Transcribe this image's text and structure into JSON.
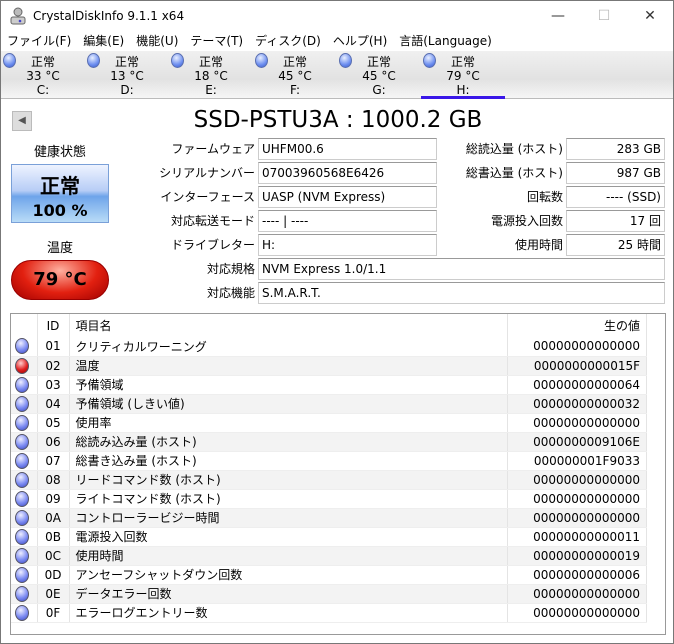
{
  "window": {
    "title": "CrystalDiskInfo 9.1.1 x64",
    "minimize": "—",
    "maximize": "☐",
    "close": "✕"
  },
  "menu": [
    "ファイル(F)",
    "編集(E)",
    "機能(U)",
    "テーマ(T)",
    "ディスク(D)",
    "ヘルプ(H)",
    "言語(Language)"
  ],
  "drives": [
    {
      "status": "正常",
      "temp": "33 °C",
      "letter": "C:"
    },
    {
      "status": "正常",
      "temp": "13 °C",
      "letter": "D:"
    },
    {
      "status": "正常",
      "temp": "18 °C",
      "letter": "E:"
    },
    {
      "status": "正常",
      "temp": "45 °C",
      "letter": "F:"
    },
    {
      "status": "正常",
      "temp": "45 °C",
      "letter": "G:"
    },
    {
      "status": "正常",
      "temp": "79 °C",
      "letter": "H:"
    }
  ],
  "disk_title": "SSD-PSTU3A : 1000.2 GB",
  "back_icon": "◀",
  "health": {
    "label": "健康状態",
    "status": "正常",
    "percent": "100 %"
  },
  "temperature": {
    "label": "温度",
    "value": "79 °C"
  },
  "info": {
    "firmware": {
      "label": "ファームウェア",
      "value": "UHFM00.6"
    },
    "serial": {
      "label": "シリアルナンバー",
      "value": "07003960568E6426"
    },
    "interface": {
      "label": "インターフェース",
      "value": "UASP (NVM Express)"
    },
    "transfer": {
      "label": "対応転送モード",
      "value": "---- | ----"
    },
    "drive_letter": {
      "label": "ドライブレター",
      "value": "H:"
    },
    "standard": {
      "label": "対応規格",
      "value": "NVM Express 1.0/1.1"
    },
    "features": {
      "label": "対応機能",
      "value": "S.M.A.R.T."
    },
    "host_reads": {
      "label": "総読込量 (ホスト)",
      "value": "283 GB"
    },
    "host_writes": {
      "label": "総書込量 (ホスト)",
      "value": "987 GB"
    },
    "rotation": {
      "label": "回転数",
      "value": "---- (SSD)"
    },
    "power_count": {
      "label": "電源投入回数",
      "value": "17 回"
    },
    "power_hours": {
      "label": "使用時間",
      "value": "25 時間"
    }
  },
  "smart": {
    "headers": {
      "id": "ID",
      "name": "項目名",
      "raw": "生の値"
    },
    "rows": [
      {
        "status": "good",
        "id": "01",
        "name": "クリティカルワーニング",
        "raw": "00000000000000"
      },
      {
        "status": "bad",
        "id": "02",
        "name": "温度",
        "raw": "0000000000015F"
      },
      {
        "status": "good",
        "id": "03",
        "name": "予備領域",
        "raw": "00000000000064"
      },
      {
        "status": "good",
        "id": "04",
        "name": "予備領域 (しきい値)",
        "raw": "00000000000032"
      },
      {
        "status": "good",
        "id": "05",
        "name": "使用率",
        "raw": "00000000000000"
      },
      {
        "status": "good",
        "id": "06",
        "name": "総読み込み量 (ホスト)",
        "raw": "0000000009106E"
      },
      {
        "status": "good",
        "id": "07",
        "name": "総書き込み量 (ホスト)",
        "raw": "000000001F9033"
      },
      {
        "status": "good",
        "id": "08",
        "name": "リードコマンド数 (ホスト)",
        "raw": "00000000000000"
      },
      {
        "status": "good",
        "id": "09",
        "name": "ライトコマンド数 (ホスト)",
        "raw": "00000000000000"
      },
      {
        "status": "good",
        "id": "0A",
        "name": "コントローラービジー時間",
        "raw": "00000000000000"
      },
      {
        "status": "good",
        "id": "0B",
        "name": "電源投入回数",
        "raw": "00000000000011"
      },
      {
        "status": "good",
        "id": "0C",
        "name": "使用時間",
        "raw": "00000000000019"
      },
      {
        "status": "good",
        "id": "0D",
        "name": "アンセーフシャットダウン回数",
        "raw": "00000000000006"
      },
      {
        "status": "good",
        "id": "0E",
        "name": "データエラー回数",
        "raw": "00000000000000"
      },
      {
        "status": "good",
        "id": "0F",
        "name": "エラーログエントリー数",
        "raw": "00000000000000"
      }
    ]
  }
}
